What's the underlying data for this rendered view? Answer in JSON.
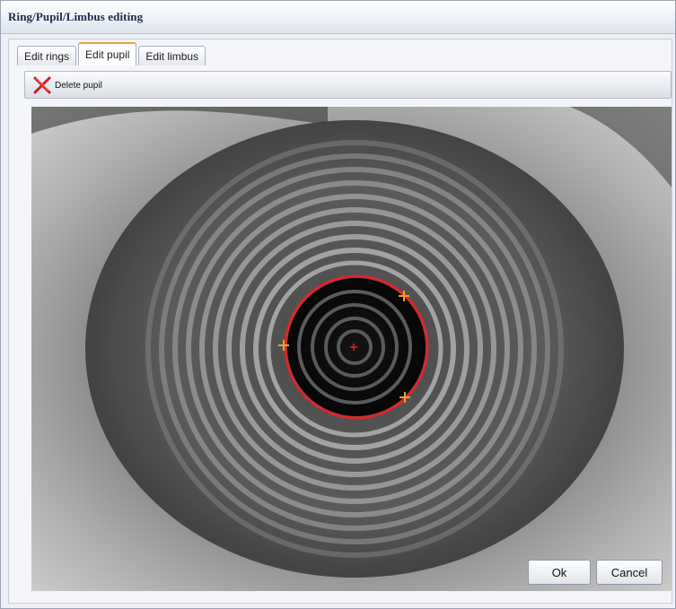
{
  "window": {
    "title": "Ring/Pupil/Limbus editing"
  },
  "tabs": [
    {
      "label": "Edit rings",
      "active": false
    },
    {
      "label": "Edit pupil",
      "active": true
    },
    {
      "label": "Edit limbus",
      "active": false
    }
  ],
  "toolbar": {
    "delete_pupil_label": "Delete pupil",
    "delete_icon": "red-x-icon"
  },
  "buttons": {
    "ok_label": "Ok",
    "cancel_label": "Cancel"
  },
  "colors": {
    "pupil_outline": "#e0242c",
    "handle": "#f0a020",
    "tab_accent": "#e8a838"
  }
}
